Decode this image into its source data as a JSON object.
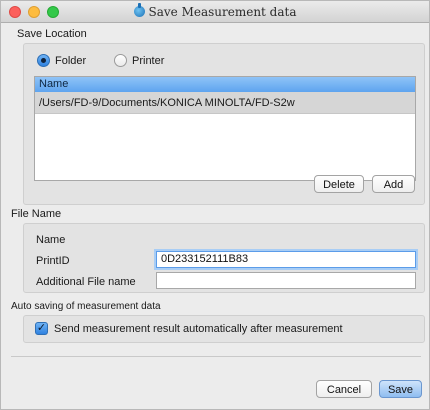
{
  "window": {
    "title": "Save Measurement data"
  },
  "save_location": {
    "label": "Save Location",
    "radio_folder": "Folder",
    "radio_printer": "Printer",
    "selected": "Folder",
    "list": {
      "header": "Name",
      "rows": [
        "/Users/FD-9/Documents/KONICA MINOLTA/FD-S2w"
      ]
    },
    "delete_label": "Delete",
    "add_label": "Add"
  },
  "file_name": {
    "label": "File Name",
    "name_label": "Name",
    "printid_label": "PrintID",
    "printid_value": "0D233152111B83",
    "additional_label": "Additional File name",
    "additional_value": ""
  },
  "auto_saving": {
    "label": "Auto saving of measurement data",
    "checkbox_label": "Send measurement result automatically after measurement",
    "checked": true
  },
  "footer": {
    "cancel_label": "Cancel",
    "save_label": "Save"
  }
}
